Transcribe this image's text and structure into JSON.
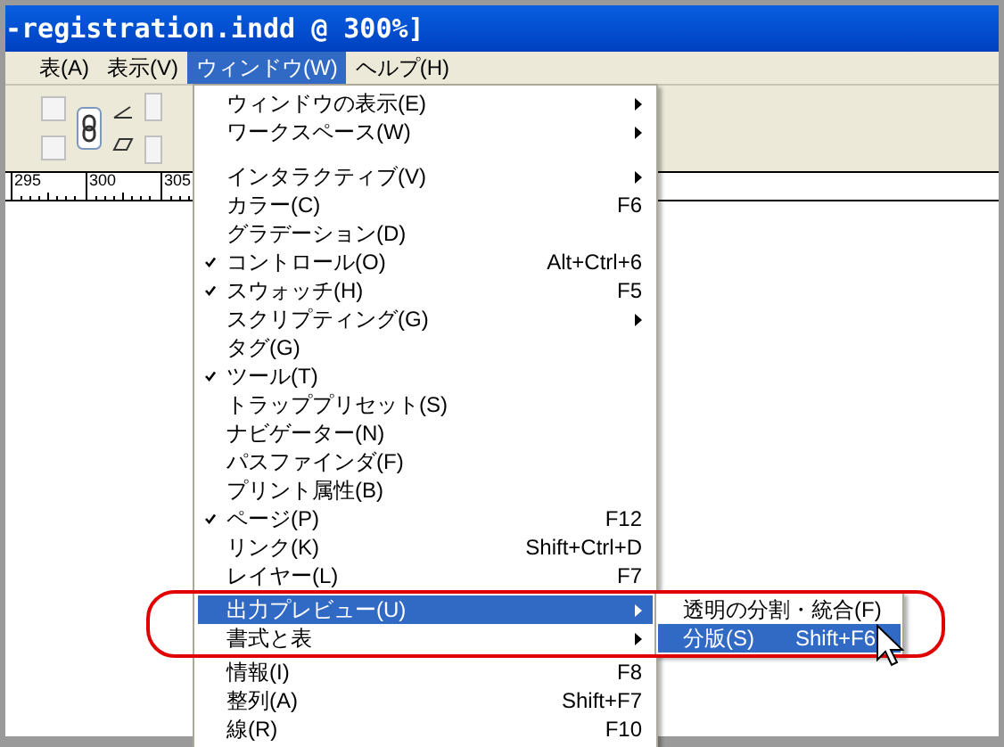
{
  "window": {
    "title": "-registration.indd @ 300%]"
  },
  "menu_bar": [
    {
      "label": "表(A)",
      "selected": false
    },
    {
      "label": "表示(V)",
      "selected": false
    },
    {
      "label": "ウィンドウ(W)",
      "selected": true
    },
    {
      "label": "ヘルプ(H)",
      "selected": false
    }
  ],
  "ruler": {
    "labels": [
      "295",
      "300",
      "305"
    ]
  },
  "window_menu": {
    "items": [
      {
        "kind": "item",
        "label": "ウィンドウの表示(E)",
        "submenu": true,
        "checked": false,
        "selected": false,
        "circled": false
      },
      {
        "kind": "item",
        "label": "ワークスペース(W)",
        "submenu": true,
        "checked": false,
        "selected": false,
        "circled": false
      },
      {
        "kind": "separator"
      },
      {
        "kind": "item",
        "label": "インタラクティブ(V)",
        "submenu": true,
        "checked": false,
        "selected": false,
        "circled": false
      },
      {
        "kind": "item",
        "label": "カラー(C)",
        "shortcut": "F6",
        "submenu": false,
        "checked": false,
        "selected": false,
        "circled": false
      },
      {
        "kind": "item",
        "label": "グラデーション(D)",
        "submenu": false,
        "checked": false,
        "selected": false,
        "circled": false
      },
      {
        "kind": "item",
        "label": "コントロール(O)",
        "shortcut": "Alt+Ctrl+6",
        "submenu": false,
        "checked": true,
        "selected": false,
        "circled": false
      },
      {
        "kind": "item",
        "label": "スウォッチ(H)",
        "shortcut": "F5",
        "submenu": false,
        "checked": true,
        "selected": false,
        "circled": false
      },
      {
        "kind": "item",
        "label": "スクリプティング(G)",
        "submenu": true,
        "checked": false,
        "selected": false,
        "circled": false
      },
      {
        "kind": "item",
        "label": "タグ(G)",
        "submenu": false,
        "checked": false,
        "selected": false,
        "circled": false
      },
      {
        "kind": "item",
        "label": "ツール(T)",
        "submenu": false,
        "checked": true,
        "selected": false,
        "circled": false
      },
      {
        "kind": "item",
        "label": "トラッププリセット(S)",
        "submenu": false,
        "checked": false,
        "selected": false,
        "circled": false
      },
      {
        "kind": "item",
        "label": "ナビゲーター(N)",
        "submenu": false,
        "checked": false,
        "selected": false,
        "circled": false
      },
      {
        "kind": "item",
        "label": "パスファインダ(F)",
        "submenu": false,
        "checked": false,
        "selected": false,
        "circled": false
      },
      {
        "kind": "item",
        "label": "プリント属性(B)",
        "submenu": false,
        "checked": false,
        "selected": false,
        "circled": false
      },
      {
        "kind": "item",
        "label": "ページ(P)",
        "shortcut": "F12",
        "submenu": false,
        "checked": true,
        "selected": false,
        "circled": false
      },
      {
        "kind": "item",
        "label": "リンク(K)",
        "shortcut": "Shift+Ctrl+D",
        "submenu": false,
        "checked": false,
        "selected": false,
        "circled": false
      },
      {
        "kind": "item",
        "label": "レイヤー(L)",
        "shortcut": "F7",
        "submenu": false,
        "checked": false,
        "selected": false,
        "circled": false
      },
      {
        "kind": "item",
        "label": "出力プレビュー(U)",
        "submenu": true,
        "checked": false,
        "selected": true,
        "circled": true
      },
      {
        "kind": "item",
        "label": "書式と表",
        "submenu": true,
        "checked": false,
        "selected": false,
        "circled": true
      },
      {
        "kind": "item",
        "label": "情報(I)",
        "shortcut": "F8",
        "submenu": false,
        "checked": false,
        "selected": false,
        "circled": false
      },
      {
        "kind": "item",
        "label": "整列(A)",
        "shortcut": "Shift+F7",
        "submenu": false,
        "checked": false,
        "selected": false,
        "circled": false
      },
      {
        "kind": "item",
        "label": "線(R)",
        "shortcut": "F10",
        "submenu": false,
        "checked": false,
        "selected": false,
        "circled": false
      }
    ]
  },
  "submenu": {
    "items": [
      {
        "label": "透明の分割・統合(F)",
        "selected": false
      },
      {
        "label": "分版(S)",
        "shortcut": "Shift+F6",
        "selected": true
      }
    ]
  }
}
